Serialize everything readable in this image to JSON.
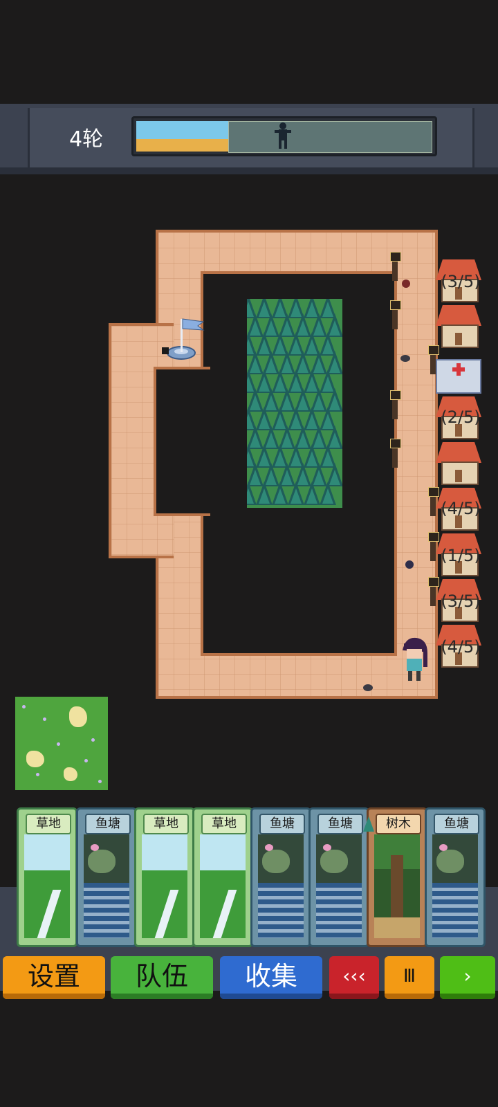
{
  "hud": {
    "round_label": "4轮",
    "round_progress_fraction": 0.31
  },
  "town": {
    "counters": [
      "(3/5)",
      "(2/5)",
      "(4/5)",
      "(1/5)",
      "(3/5)",
      "(4/5)"
    ]
  },
  "cards": [
    {
      "title": "草地",
      "kind": "grass"
    },
    {
      "title": "鱼塘",
      "kind": "pond"
    },
    {
      "title": "草地",
      "kind": "grass"
    },
    {
      "title": "草地",
      "kind": "grass"
    },
    {
      "title": "鱼塘",
      "kind": "pond"
    },
    {
      "title": "鱼塘",
      "kind": "pond"
    },
    {
      "title": "树木",
      "kind": "tree"
    },
    {
      "title": "鱼塘",
      "kind": "pond"
    }
  ],
  "controls": {
    "settings": "设置",
    "team": "队伍",
    "collect": "收集",
    "rewind": "‹‹‹",
    "pause": "Ⅲ",
    "play": "›"
  },
  "colors": {
    "path": "#e9b896",
    "path_border": "#b87247",
    "settings_button": "#f39a14",
    "team_button": "#48b33c",
    "collect_button": "#2f6bd0",
    "rewind_button": "#c9232b",
    "play_button": "#4fbe16"
  },
  "icons": [
    "boss-silhouette-icon",
    "flag-icon",
    "hospital-icon",
    "house-icon",
    "lamp-post-icon",
    "player-character-icon",
    "enemy-icon"
  ]
}
